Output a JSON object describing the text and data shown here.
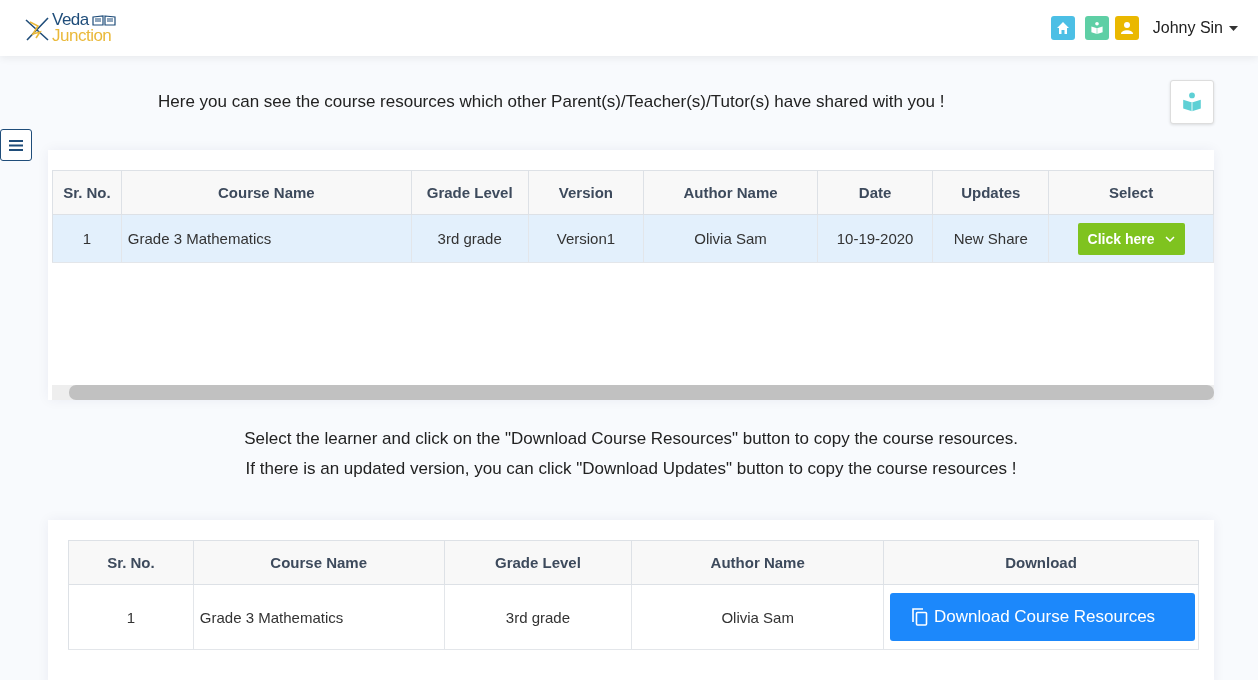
{
  "header": {
    "logo": {
      "line_1": "Veda",
      "line_2": "Junction"
    },
    "user_name": "Johny Sin"
  },
  "intro": "Here you can see the course resources which other Parent(s)/Teacher(s)/Tutor(s) have shared with you !",
  "shared_table": {
    "columns": [
      "Sr. No.",
      "Course Name",
      "Grade Level",
      "Version",
      "Author Name",
      "Date",
      "Updates",
      "Select"
    ],
    "rows": [
      {
        "cells": [
          "1",
          "Grade 3 Mathematics",
          "3rd grade",
          "Version1",
          "Olivia Sam",
          "10-19-2020",
          "New Share"
        ],
        "selected": true,
        "action": "Click here"
      }
    ]
  },
  "instructions": [
    "Select the learner and click on the \"Download Course Resources\" button to copy the course resources.",
    "If there is an updated version, you can click \"Download Updates\" button to copy the course resources !"
  ],
  "download_table": {
    "columns": [
      "Sr. No.",
      "Course Name",
      "Grade Level",
      "Author Name",
      "Download"
    ],
    "rows": [
      {
        "cells": [
          "1",
          "Grade 3 Mathematics",
          "3rd grade",
          "Olivia Sam"
        ],
        "action": "Download Course Resources"
      }
    ]
  }
}
